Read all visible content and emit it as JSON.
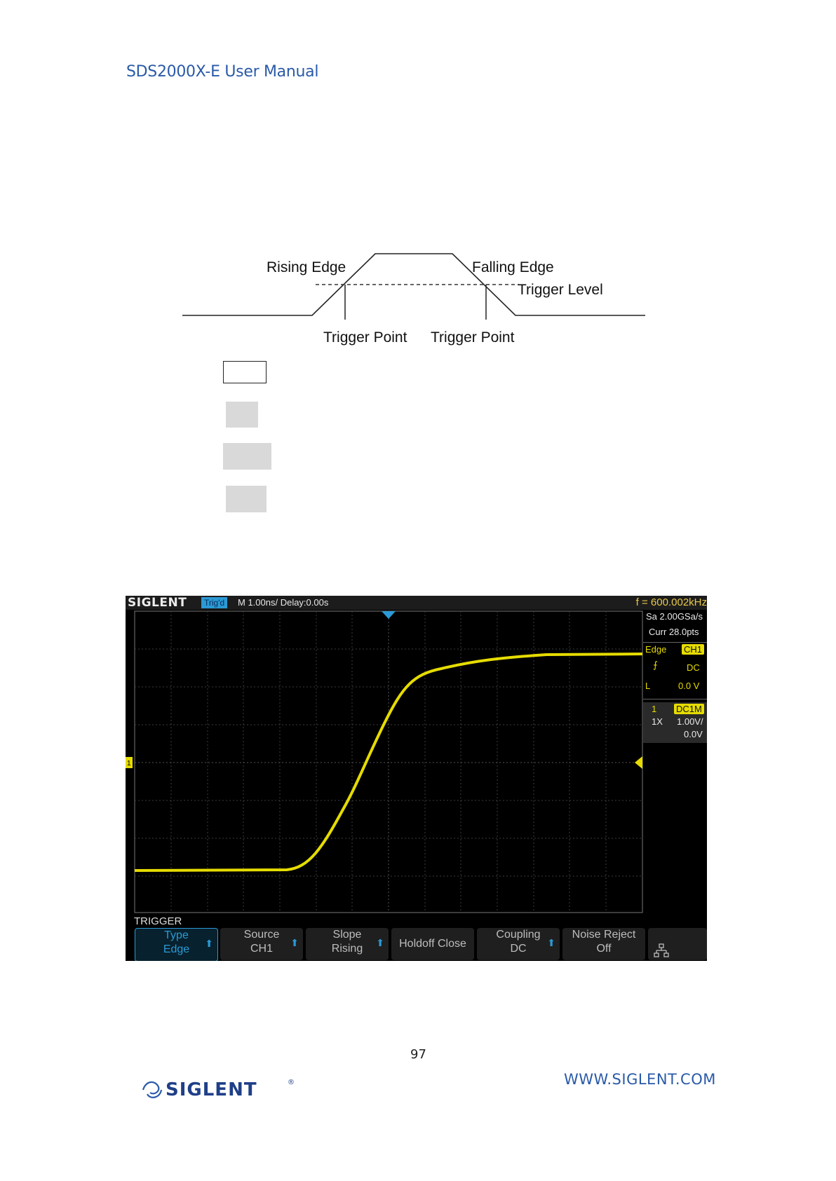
{
  "header": {
    "title": "SDS2000X-E User Manual"
  },
  "diagram": {
    "rising_edge": "Rising Edge",
    "falling_edge": "Falling Edge",
    "trigger_level": "Trigger Level",
    "trigger_point_left": "Trigger Point",
    "trigger_point_right": "Trigger Point"
  },
  "scope": {
    "brand": "SIGLENT",
    "status": "Trig'd",
    "timebase": "M 1.00ns/  Delay:0.00s",
    "frequency": "f = 600.002kHz",
    "sample_rate": "Sa 2.00GSa/s",
    "curr_points": "Curr 28.0pts",
    "trigger_type": "Edge",
    "trigger_source": "CH1",
    "trigger_coupling": "DC",
    "trigger_level_label": "L",
    "trigger_level_value": "0.0 V",
    "ch_number": "1",
    "ch_coupling": "DC1M",
    "ch_probe": "1X",
    "ch_scale": "1.00V/",
    "ch_offset": "0.0V",
    "ch_marker": "1",
    "menu_title": "TRIGGER",
    "softkeys": [
      {
        "line1": "Type",
        "line2": "Edge",
        "arrow": true,
        "active": true
      },
      {
        "line1": "Source",
        "line2": "CH1",
        "arrow": true,
        "active": false
      },
      {
        "line1": "Slope",
        "line2": "Rising",
        "arrow": true,
        "active": false
      },
      {
        "line1": "Holdoff Close",
        "line2": "",
        "arrow": false,
        "active": false
      },
      {
        "line1": "Coupling",
        "line2": "DC",
        "arrow": true,
        "active": false
      },
      {
        "line1": "Noise Reject",
        "line2": "Off",
        "arrow": false,
        "active": false
      }
    ],
    "colors": {
      "trace": "#e6dc00",
      "accent": "#2a9ad6",
      "grid": "#444444"
    }
  },
  "footer": {
    "page_number": "97",
    "logo": "SIGLENT",
    "url": "WWW.SIGLENT.COM"
  }
}
